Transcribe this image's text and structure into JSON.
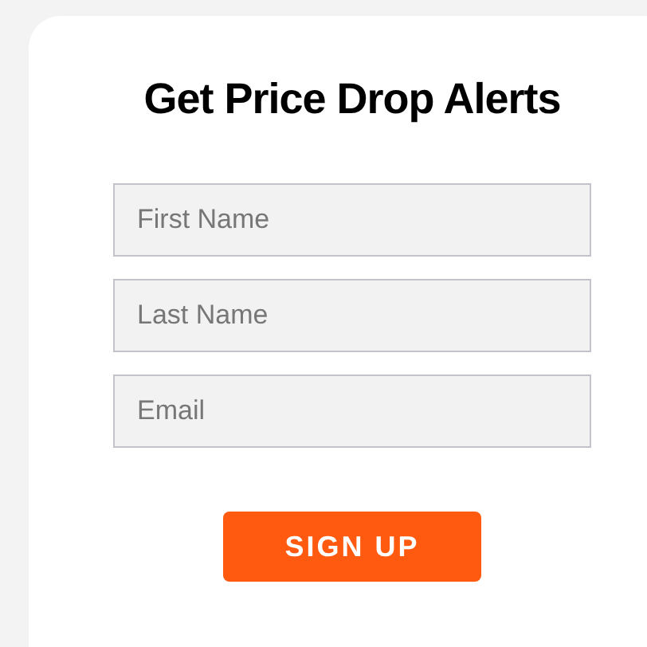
{
  "title": "Get Price Drop Alerts",
  "fields": [
    {
      "placeholder": "First Name"
    },
    {
      "placeholder": "Last Name"
    },
    {
      "placeholder": "Email"
    }
  ],
  "button": "SIGN UP"
}
